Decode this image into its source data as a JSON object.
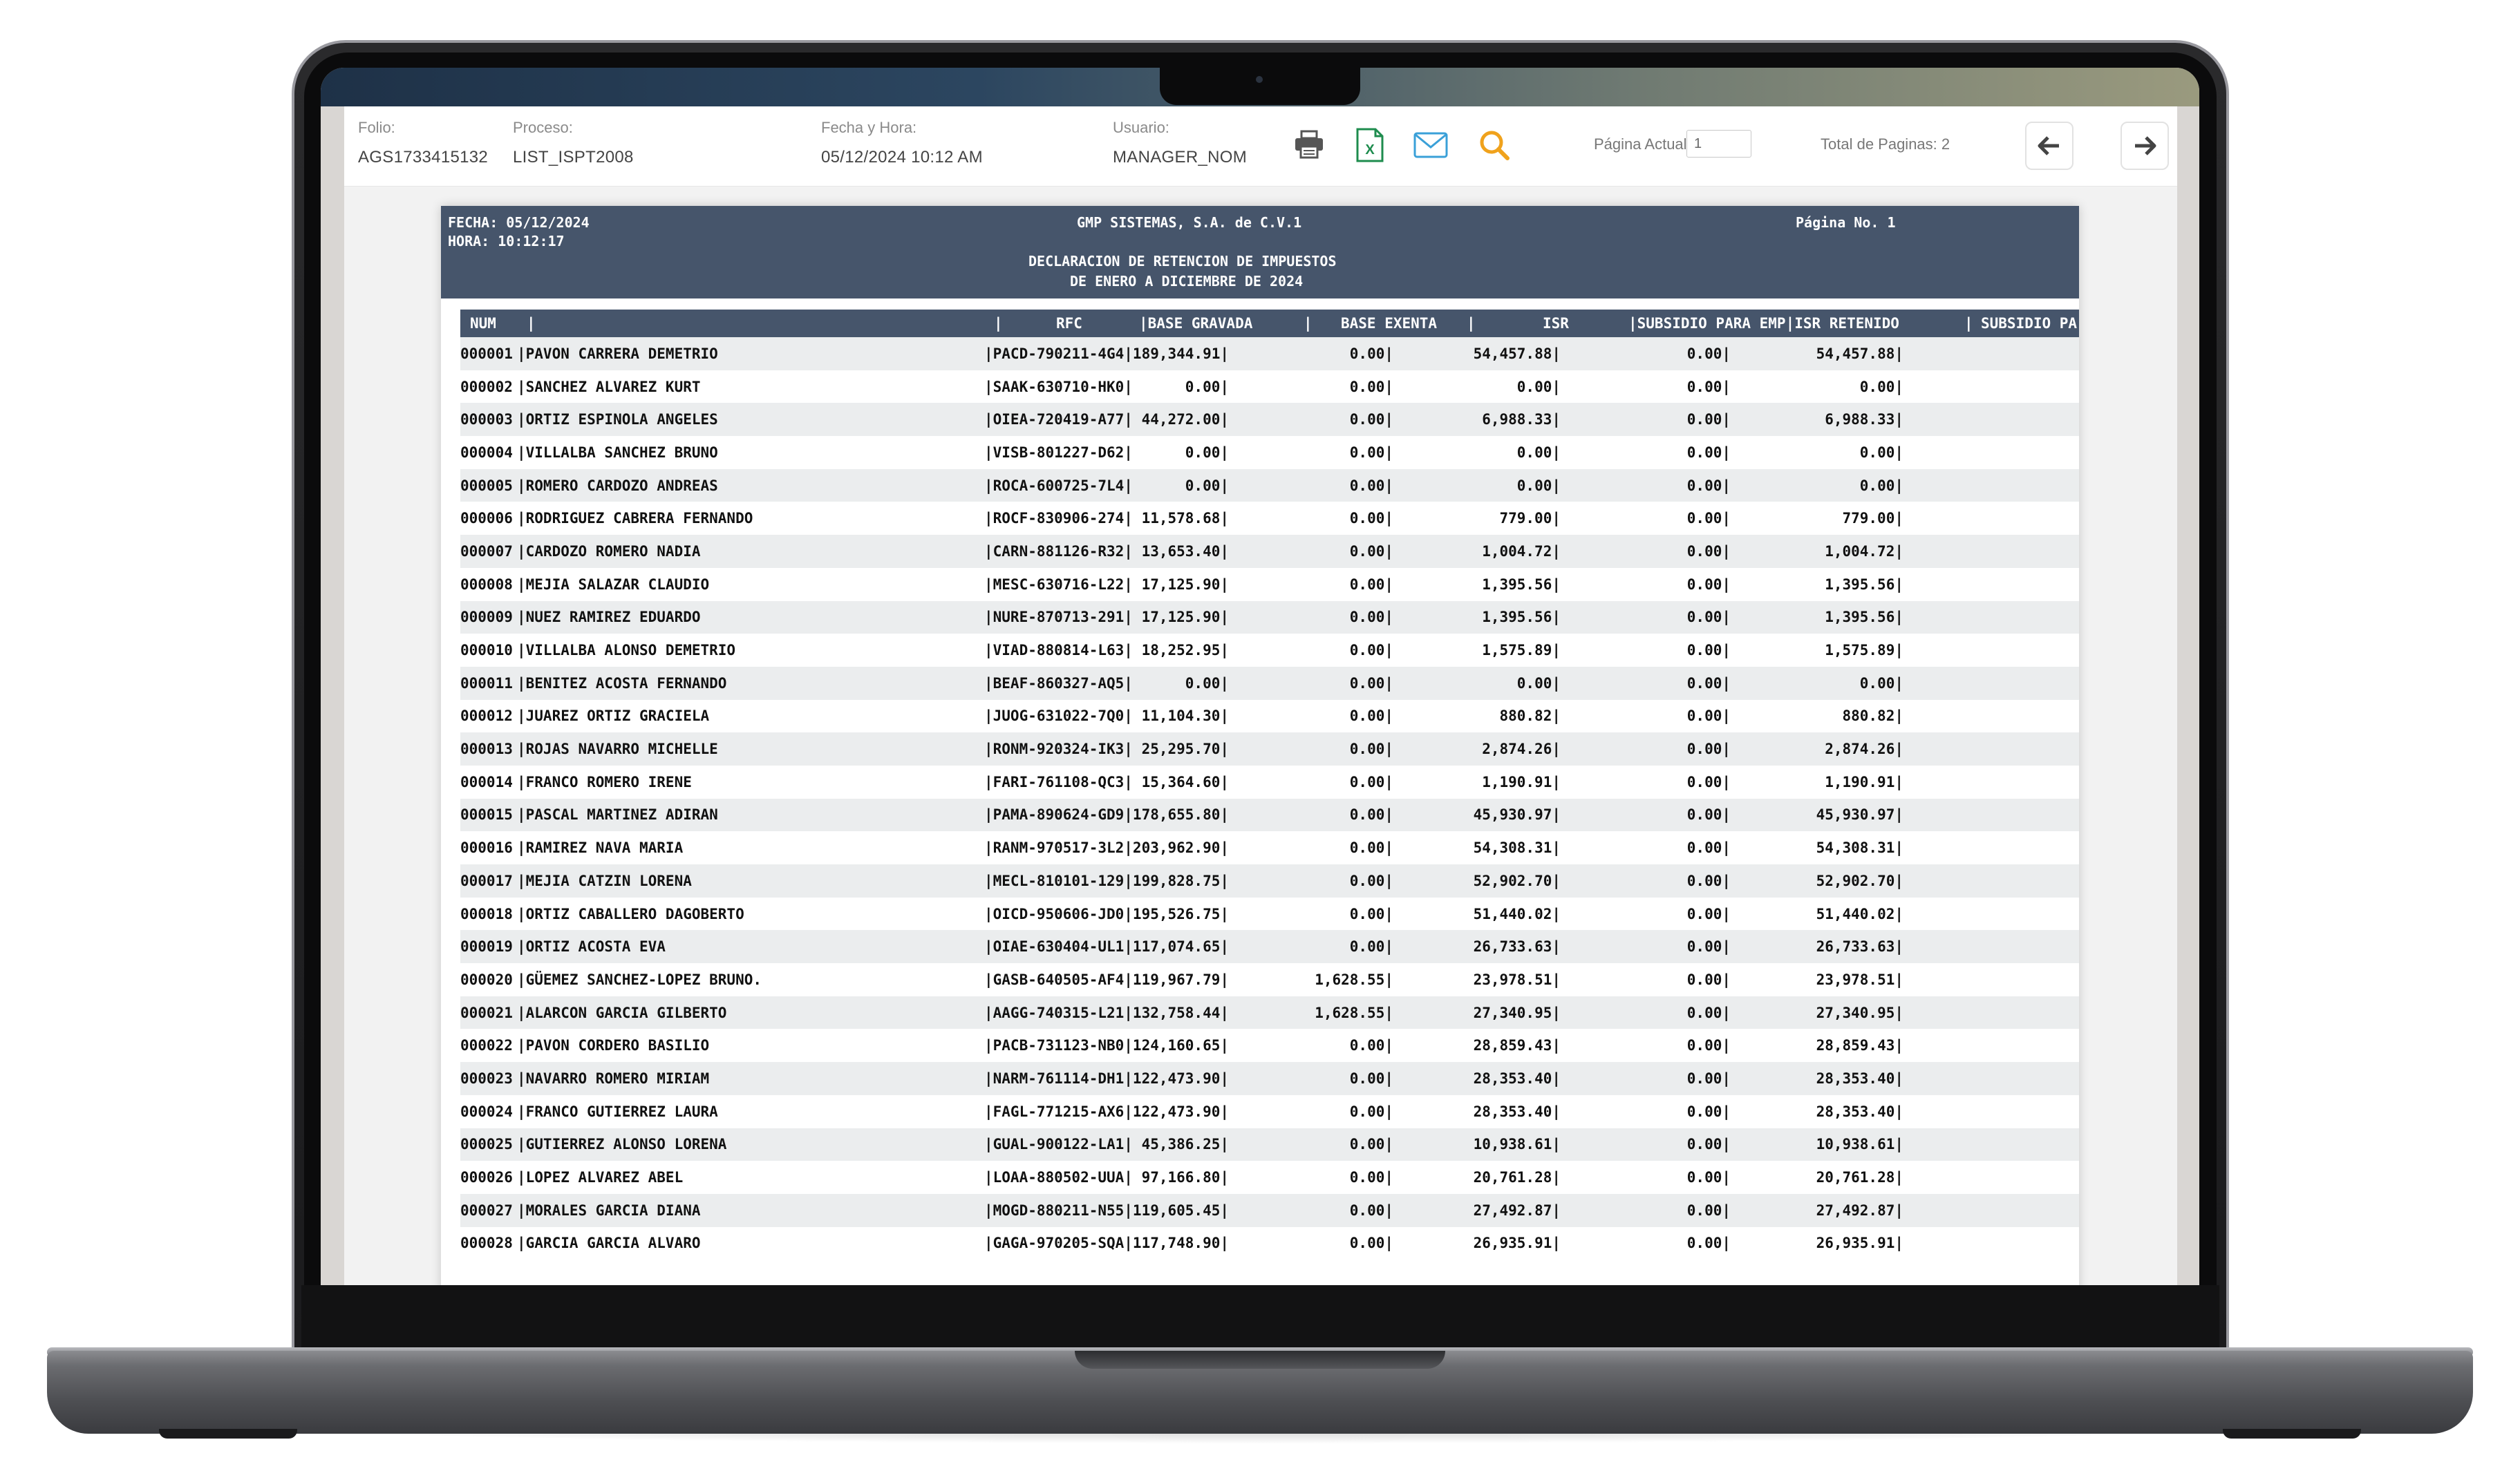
{
  "toolbar": {
    "folio_label": "Folio:",
    "folio_value": "AGS1733415132",
    "proceso_label": "Proceso:",
    "proceso_value": "LIST_ISPT2008",
    "fecha_label": "Fecha y Hora:",
    "fecha_value": "05/12/2024 10:12 AM",
    "usuario_label": "Usuario:",
    "usuario_value": "MANAGER_NOM",
    "pagina_actual_label": "Página Actual:",
    "pagina_actual_value": "1",
    "total_paginas_label": "Total de Paginas: 2",
    "icons": [
      "print-icon",
      "excel-icon",
      "mail-icon",
      "search-icon",
      "arrow-left-icon",
      "arrow-right-icon"
    ],
    "colors": {
      "print": "#555555",
      "excel": "#1e8c4e",
      "mail": "#3aa0d8",
      "search": "#f0a21c"
    }
  },
  "report": {
    "fecha": "FECHA: 05/12/2024",
    "hora": "HORA: 10:12:17",
    "company": "GMP SISTEMAS, S.A. de C.V.1",
    "pagina": "Página No. 1",
    "title1": "DECLARACION DE RETENCION DE IMPUESTOS",
    "title2": "DE ENERO A DICIEMBRE DE 2024",
    "header_color": "#46556b",
    "columns": {
      "num": "NUM",
      "sep1": "|",
      "sep2": "|",
      "rfc": "RFC",
      "base_gravada": "|BASE GRAVADA",
      "sep3": "|",
      "base_exenta": "BASE EXENTA",
      "sep4": "|",
      "isr": "ISR",
      "subsidio_emp": "|SUBSIDIO PARA EMP|ISR RETENIDO",
      "sep5": "|",
      "subsidio_pa": "SUBSIDIO PA"
    },
    "rows": [
      {
        "num": "000001",
        "name": "|PAVON CARRERA DEMETRIO",
        "rfc": "|PACD-790211-4G4|",
        "bg": "189,344.91|",
        "be": "0.00|",
        "isr": "54,457.88|",
        "sub": "0.00|",
        "ret": "54,457.88|"
      },
      {
        "num": "000002",
        "name": "|SANCHEZ ALVAREZ KURT",
        "rfc": "|SAAK-630710-HK0|",
        "bg": "0.00|",
        "be": "0.00|",
        "isr": "0.00|",
        "sub": "0.00|",
        "ret": "0.00|"
      },
      {
        "num": "000003",
        "name": "|ORTIZ ESPINOLA ANGELES",
        "rfc": "|OIEA-720419-A77|",
        "bg": "44,272.00|",
        "be": "0.00|",
        "isr": "6,988.33|",
        "sub": "0.00|",
        "ret": "6,988.33|"
      },
      {
        "num": "000004",
        "name": "|VILLALBA SANCHEZ BRUNO",
        "rfc": "|VISB-801227-D62|",
        "bg": "0.00|",
        "be": "0.00|",
        "isr": "0.00|",
        "sub": "0.00|",
        "ret": "0.00|"
      },
      {
        "num": "000005",
        "name": "|ROMERO CARDOZO ANDREAS",
        "rfc": "|ROCA-600725-7L4|",
        "bg": "0.00|",
        "be": "0.00|",
        "isr": "0.00|",
        "sub": "0.00|",
        "ret": "0.00|"
      },
      {
        "num": "000006",
        "name": "|RODRIGUEZ CABRERA FERNANDO",
        "rfc": "|ROCF-830906-274|",
        "bg": "11,578.68|",
        "be": "0.00|",
        "isr": "779.00|",
        "sub": "0.00|",
        "ret": "779.00|"
      },
      {
        "num": "000007",
        "name": "|CARDOZO ROMERO NADIA",
        "rfc": "|CARN-881126-R32|",
        "bg": "13,653.40|",
        "be": "0.00|",
        "isr": "1,004.72|",
        "sub": "0.00|",
        "ret": "1,004.72|"
      },
      {
        "num": "000008",
        "name": "|MEJIA SALAZAR CLAUDIO",
        "rfc": "|MESC-630716-L22|",
        "bg": "17,125.90|",
        "be": "0.00|",
        "isr": "1,395.56|",
        "sub": "0.00|",
        "ret": "1,395.56|"
      },
      {
        "num": "000009",
        "name": "|NUEZ RAMIREZ EDUARDO",
        "rfc": "|NURE-870713-291|",
        "bg": "17,125.90|",
        "be": "0.00|",
        "isr": "1,395.56|",
        "sub": "0.00|",
        "ret": "1,395.56|"
      },
      {
        "num": "000010",
        "name": "|VILLALBA ALONSO DEMETRIO",
        "rfc": "|VIAD-880814-L63|",
        "bg": "18,252.95|",
        "be": "0.00|",
        "isr": "1,575.89|",
        "sub": "0.00|",
        "ret": "1,575.89|"
      },
      {
        "num": "000011",
        "name": "|BENITEZ ACOSTA FERNANDO",
        "rfc": "|BEAF-860327-AQ5|",
        "bg": "0.00|",
        "be": "0.00|",
        "isr": "0.00|",
        "sub": "0.00|",
        "ret": "0.00|"
      },
      {
        "num": "000012",
        "name": "|JUAREZ ORTIZ GRACIELA",
        "rfc": "|JUOG-631022-7Q0|",
        "bg": "11,104.30|",
        "be": "0.00|",
        "isr": "880.82|",
        "sub": "0.00|",
        "ret": "880.82|"
      },
      {
        "num": "000013",
        "name": "|ROJAS NAVARRO MICHELLE",
        "rfc": "|RONM-920324-IK3|",
        "bg": "25,295.70|",
        "be": "0.00|",
        "isr": "2,874.26|",
        "sub": "0.00|",
        "ret": "2,874.26|"
      },
      {
        "num": "000014",
        "name": "|FRANCO ROMERO IRENE",
        "rfc": "|FARI-761108-QC3|",
        "bg": "15,364.60|",
        "be": "0.00|",
        "isr": "1,190.91|",
        "sub": "0.00|",
        "ret": "1,190.91|"
      },
      {
        "num": "000015",
        "name": "|PASCAL MARTINEZ ADIRAN",
        "rfc": "|PAMA-890624-GD9|",
        "bg": "178,655.80|",
        "be": "0.00|",
        "isr": "45,930.97|",
        "sub": "0.00|",
        "ret": "45,930.97|"
      },
      {
        "num": "000016",
        "name": "|RAMIREZ NAVA MARIA",
        "rfc": "|RANM-970517-3L2|",
        "bg": "203,962.90|",
        "be": "0.00|",
        "isr": "54,308.31|",
        "sub": "0.00|",
        "ret": "54,308.31|"
      },
      {
        "num": "000017",
        "name": "|MEJIA CATZIN LORENA",
        "rfc": "|MECL-810101-129|",
        "bg": "199,828.75|",
        "be": "0.00|",
        "isr": "52,902.70|",
        "sub": "0.00|",
        "ret": "52,902.70|"
      },
      {
        "num": "000018",
        "name": "|ORTIZ CABALLERO DAGOBERTO",
        "rfc": "|OICD-950606-JD0|",
        "bg": "195,526.75|",
        "be": "0.00|",
        "isr": "51,440.02|",
        "sub": "0.00|",
        "ret": "51,440.02|"
      },
      {
        "num": "000019",
        "name": "|ORTIZ ACOSTA EVA",
        "rfc": "|OIAE-630404-UL1|",
        "bg": "117,074.65|",
        "be": "0.00|",
        "isr": "26,733.63|",
        "sub": "0.00|",
        "ret": "26,733.63|"
      },
      {
        "num": "000020",
        "name": "|GÜEMEZ SANCHEZ-LOPEZ BRUNO.",
        "rfc": "|GASB-640505-AF4|",
        "bg": "119,967.79|",
        "be": "1,628.55|",
        "isr": "23,978.51|",
        "sub": "0.00|",
        "ret": "23,978.51|"
      },
      {
        "num": "000021",
        "name": "|ALARCON GARCIA GILBERTO",
        "rfc": "|AAGG-740315-L21|",
        "bg": "132,758.44|",
        "be": "1,628.55|",
        "isr": "27,340.95|",
        "sub": "0.00|",
        "ret": "27,340.95|"
      },
      {
        "num": "000022",
        "name": "|PAVON CORDERO BASILIO",
        "rfc": "|PACB-731123-NB0|",
        "bg": "124,160.65|",
        "be": "0.00|",
        "isr": "28,859.43|",
        "sub": "0.00|",
        "ret": "28,859.43|"
      },
      {
        "num": "000023",
        "name": "|NAVARRO ROMERO MIRIAM",
        "rfc": "|NARM-761114-DH1|",
        "bg": "122,473.90|",
        "be": "0.00|",
        "isr": "28,353.40|",
        "sub": "0.00|",
        "ret": "28,353.40|"
      },
      {
        "num": "000024",
        "name": "|FRANCO GUTIERREZ LAURA",
        "rfc": "|FAGL-771215-AX6|",
        "bg": "122,473.90|",
        "be": "0.00|",
        "isr": "28,353.40|",
        "sub": "0.00|",
        "ret": "28,353.40|"
      },
      {
        "num": "000025",
        "name": "|GUTIERREZ ALONSO LORENA",
        "rfc": "|GUAL-900122-LA1|",
        "bg": "45,386.25|",
        "be": "0.00|",
        "isr": "10,938.61|",
        "sub": "0.00|",
        "ret": "10,938.61|"
      },
      {
        "num": "000026",
        "name": "|LOPEZ ALVAREZ ABEL",
        "rfc": "|LOAA-880502-UUA|",
        "bg": "97,166.80|",
        "be": "0.00|",
        "isr": "20,761.28|",
        "sub": "0.00|",
        "ret": "20,761.28|"
      },
      {
        "num": "000027",
        "name": "|MORALES GARCIA DIANA",
        "rfc": "|MOGD-880211-N55|",
        "bg": "119,605.45|",
        "be": "0.00|",
        "isr": "27,492.87|",
        "sub": "0.00|",
        "ret": "27,492.87|"
      },
      {
        "num": "000028",
        "name": "|GARCIA GARCIA ALVARO",
        "rfc": "|GAGA-970205-SQA|",
        "bg": "117,748.90|",
        "be": "0.00|",
        "isr": "26,935.91|",
        "sub": "0.00|",
        "ret": "26,935.91|"
      }
    ]
  }
}
